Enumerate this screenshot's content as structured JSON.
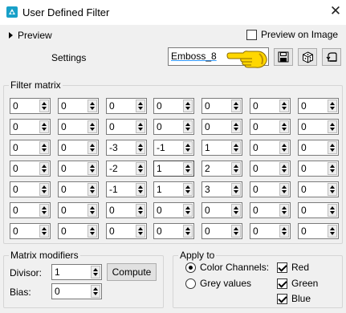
{
  "window": {
    "title": "User Defined Filter",
    "close_glyph": "✕",
    "app_icon": "paintshop-app-icon"
  },
  "preview": {
    "toggle_label": "Preview",
    "preview_on_image_label": "Preview on Image",
    "preview_on_image_checked": false
  },
  "settings": {
    "label": "Settings",
    "preset_value": "Emboss_8",
    "pointer_icon": "pointing-hand-icon",
    "buttons": [
      {
        "name": "save-preset-button",
        "icon": "floppy-disk-icon"
      },
      {
        "name": "randomize-button",
        "icon": "dice-icon"
      },
      {
        "name": "reset-button",
        "icon": "reset-arrow-icon"
      }
    ]
  },
  "filter_matrix": {
    "title": "Filter matrix",
    "rows": [
      [
        "0",
        "0",
        "0",
        "0",
        "0",
        "0",
        "0"
      ],
      [
        "0",
        "0",
        "0",
        "0",
        "0",
        "0",
        "0"
      ],
      [
        "0",
        "0",
        "-3",
        "-1",
        "1",
        "0",
        "0"
      ],
      [
        "0",
        "0",
        "-2",
        "1",
        "2",
        "0",
        "0"
      ],
      [
        "0",
        "0",
        "-1",
        "1",
        "3",
        "0",
        "0"
      ],
      [
        "0",
        "0",
        "0",
        "0",
        "0",
        "0",
        "0"
      ],
      [
        "0",
        "0",
        "0",
        "0",
        "0",
        "0",
        "0"
      ]
    ]
  },
  "matrix_modifiers": {
    "title": "Matrix modifiers",
    "divisor_label": "Divisor:",
    "divisor_value": "1",
    "compute_label": "Compute",
    "bias_label": "Bias:",
    "bias_value": "0"
  },
  "apply_to": {
    "title": "Apply to",
    "color_channels_label": "Color Channels:",
    "color_channels_selected": true,
    "grey_values_label": "Grey values",
    "red_label": "Red",
    "green_label": "Green",
    "blue_label": "Blue",
    "red_checked": true,
    "green_checked": true,
    "blue_checked": true
  },
  "colors": {
    "window_bg": "#f0f0f0",
    "titlebar_bg": "#ffffff",
    "app_icon": "#18a0c8",
    "hand_yellow": "#ffd700"
  }
}
